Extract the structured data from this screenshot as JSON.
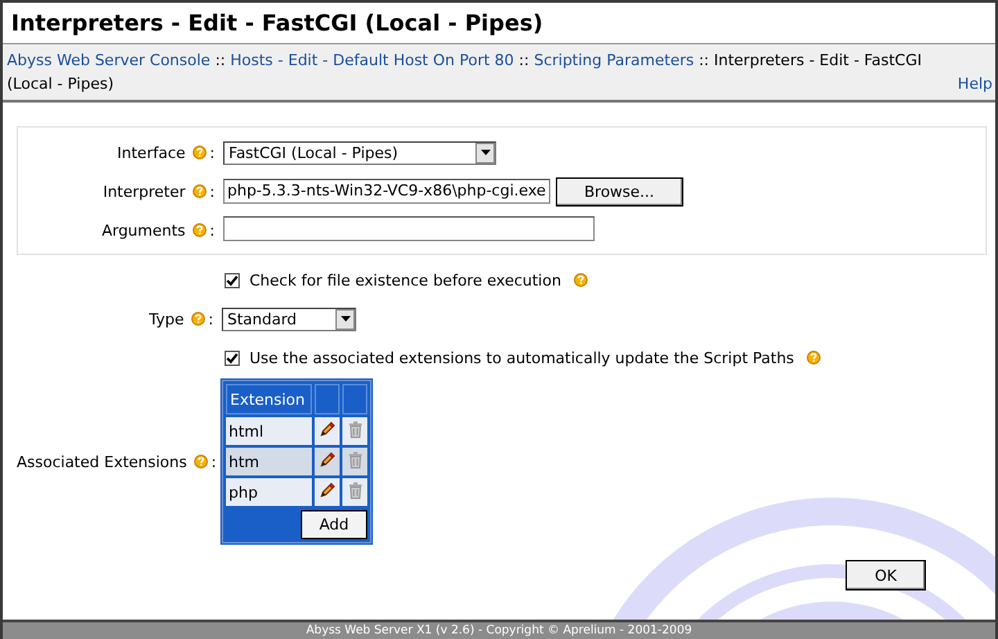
{
  "window": {
    "title": "Interpreters - Edit - FastCGI (Local - Pipes)"
  },
  "breadcrumb": [
    {
      "text": "Abyss Web Server Console",
      "kind": "link"
    },
    {
      "text": "::",
      "kind": "separator"
    },
    {
      "text": "Hosts - Edit - Default Host On Port 80",
      "kind": "link"
    },
    {
      "text": "::",
      "kind": "separator"
    },
    {
      "text": "Scripting Parameters",
      "kind": "link"
    },
    {
      "text": "::",
      "kind": "separator"
    },
    {
      "text": "Interpreters - Edit - FastCGI (Local - Pipes)",
      "kind": "current"
    }
  ],
  "help": "Help",
  "panel_fields": [
    {
      "kind": "select",
      "label": "Interface",
      "colon": ":",
      "value": "FastCGI (Local - Pipes)"
    },
    {
      "kind": "file",
      "label": "Interpreter",
      "colon": ":",
      "value": "php-5.3.3-nts-Win32-VC9-x86\\php-cgi.exe",
      "button": "Browse..."
    },
    {
      "kind": "text",
      "label": "Arguments",
      "colon": ":"
    }
  ],
  "fields": [
    {
      "kind": "checkbox",
      "label": "Check for file existence before execution",
      "checked": true
    },
    {
      "kind": "select",
      "label": "Type",
      "colon": ":",
      "value": "Standard"
    },
    {
      "kind": "checkbox",
      "label": "Use the associated extensions to automatically update the Script Paths",
      "checked": true
    },
    {
      "kind": "table",
      "label": "Associated Extensions",
      "colon": ":",
      "column": "Extension",
      "button": "Add",
      "rows": [
        {
          "text": "html",
          "selected": false
        },
        {
          "text": "htm",
          "selected": true
        },
        {
          "text": "php",
          "selected": false
        }
      ]
    }
  ],
  "ok": "OK",
  "footer": "Abyss Web Server X1 (v 2.6) - Copyright © Aprelium - 2001-2009"
}
